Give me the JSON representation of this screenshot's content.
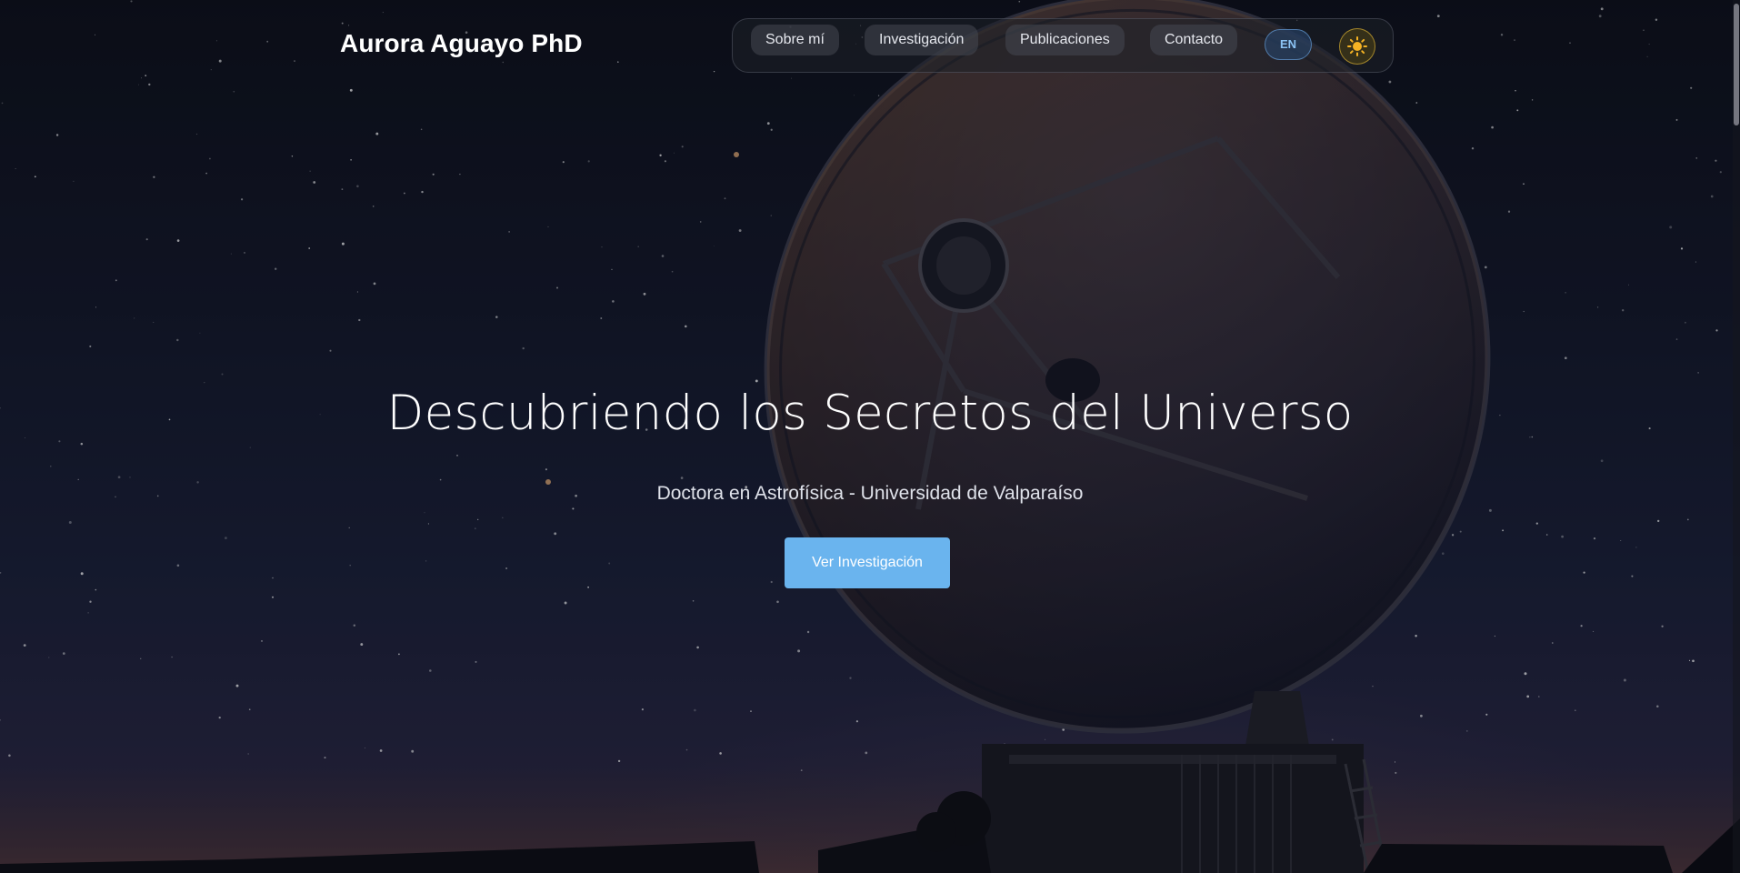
{
  "header": {
    "brand": "Aurora Aguayo PhD",
    "nav": [
      {
        "label": "Sobre mí"
      },
      {
        "label": "Investigación"
      },
      {
        "label": "Publicaciones"
      },
      {
        "label": "Contacto"
      }
    ],
    "language_button": "EN",
    "theme_icon": "sun-icon"
  },
  "hero": {
    "title": "Descubriendo los Secretos del Universo",
    "subtitle": "Doctora en Astrofísica - Universidad de Valparaíso",
    "cta_label": "Ver Investigación",
    "background": "night-sky-radio-telescope-photo"
  },
  "colors": {
    "accent": "#6ab4ee",
    "lang_text": "#8cc4f5",
    "theme_icon": "#f5b324",
    "background": "#131728"
  }
}
